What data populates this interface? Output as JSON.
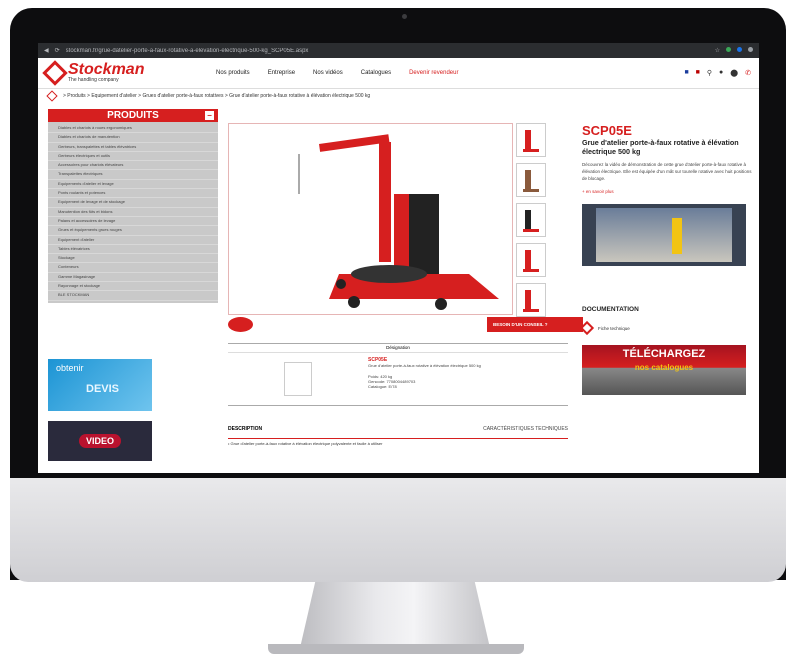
{
  "browser": {
    "url": "stockman.fr/grue-datelier-porte-a-faux-rotative-a-elevation-electrique-500-kg_SCP05E.aspx"
  },
  "logo": {
    "brand": "Stockman",
    "tagline": "The handling company"
  },
  "nav": {
    "items": [
      "Nos produits",
      "Entreprise",
      "Nos vidéos",
      "Catalogues"
    ],
    "cta": "Devenir revendeur"
  },
  "breadcrumb": "> Produits > Equipement d'atelier > Grues d'atelier porte-à-faux rotatives > Grue d'atelier porte-à-faux rotative à élévation électrique 500 kg",
  "sidebar": {
    "title": "PRODUITS",
    "collapse": "−",
    "categories": [
      "Diables et chariots à roues ergonomiques",
      "Diables et chariots de manutention",
      "Gerbeurs, transpalettes et tables élévatrices",
      "Gerbeurs électriques et outils",
      "Accessoires pour chariots élévateurs",
      "Transpalettes électriques",
      "Equipements d'atelier et levage",
      "Ponts roulants et potences",
      "Equipement de levage et de stockage",
      "Manutention des fûts et bidons",
      "Palans et accessoires de levage",
      "Grues et équipements grues rouges",
      "Equipement d'atelier",
      "Tables élévatrices",
      "Stockage",
      "Conteneurs",
      "Gamme Magasinage",
      "Rayonnage et stockage",
      "BLE STOCKMAN"
    ]
  },
  "banners": {
    "devis_line1": "obtenir",
    "devis_line2": "DEVIS",
    "video": "VIDEO"
  },
  "help_button": "BESOIN D'UN CONSEIL ?",
  "table": {
    "header": "Désignation",
    "code": "SCP05E",
    "line1": "Grue d'atelier porte-à-faux rotative à élévation électrique 500 kg",
    "poids": "Poids: 420 kg",
    "gencode": "Gencode: 7708004489703",
    "catalogue": "Catalogue: E/78"
  },
  "tabs": {
    "description": "DESCRIPTION",
    "caracteristiques": "CARACTÉRISTIQUES TECHNIQUES"
  },
  "desc_line": "• Grue d'atelier porte-à-faux rotative à élévation électrique polyvalente et facile à utiliser",
  "product": {
    "sku": "SCP05E",
    "title": "Grue d'atelier porte-à-faux rotative à élévation électrique 500 kg",
    "description": "Découvrez la vidéo de démonstration de cette grue d'atelier porte-à-faux rotative à élévation électrique. Elle est équipée d'un mât sur tourelle rotative avec huit positions de blocage.",
    "more": "+ en savoir plus"
  },
  "documentation": {
    "title": "DOCUMENTATION",
    "fiche": "Fiche technique"
  },
  "telechargez": {
    "line1": "TÉLÉCHARGEZ",
    "line2": "nos catalogues"
  }
}
